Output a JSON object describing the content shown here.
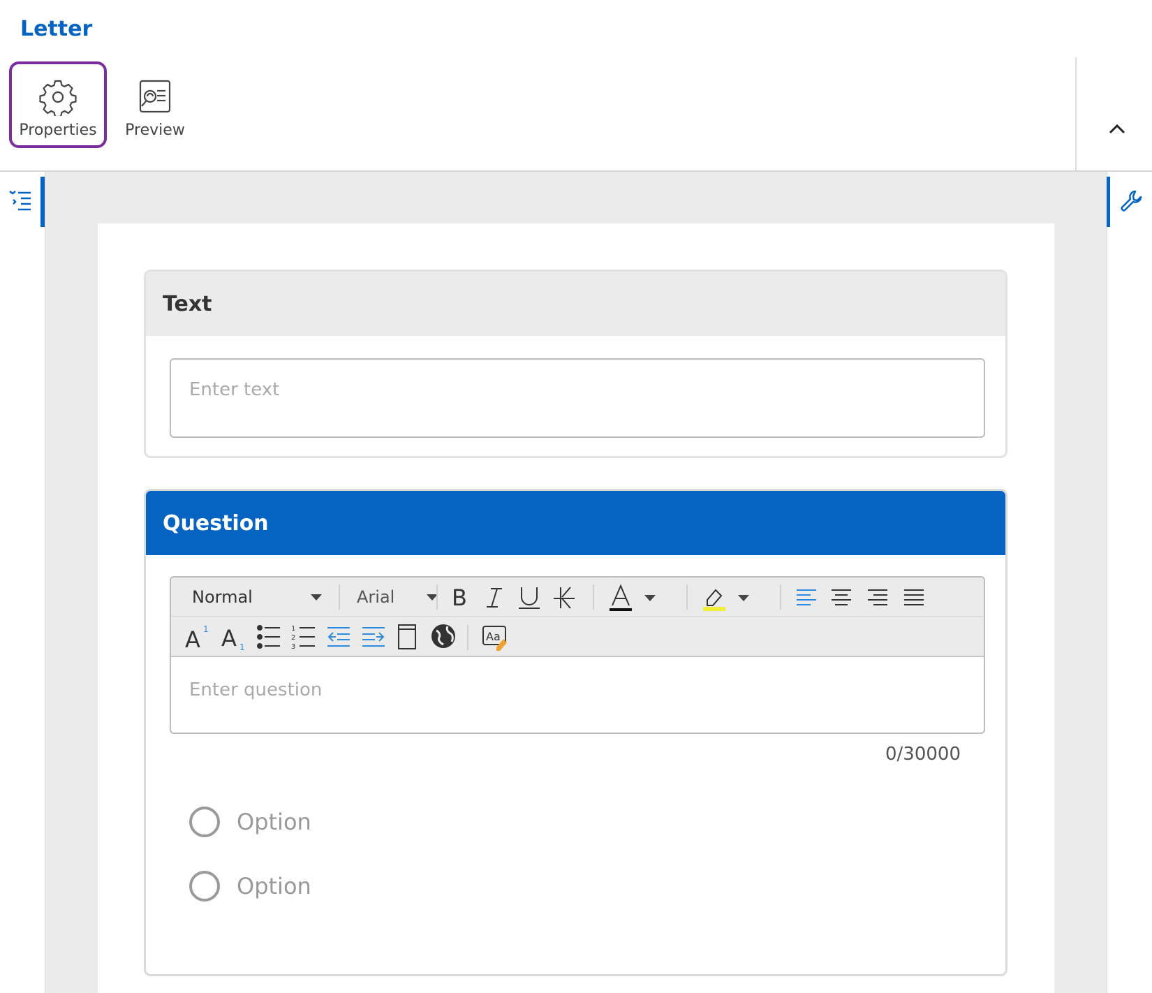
{
  "app": {
    "title": "Letter"
  },
  "toolbar": {
    "properties_label": "Properties",
    "preview_label": "Preview",
    "selected": "Properties",
    "accent_selected": "#7b2d9e"
  },
  "icons": {
    "properties": "gear-icon",
    "preview": "preview-icon",
    "collapse": "chevron-up-icon",
    "outline": "outline-list-icon",
    "tools": "wrench-icon"
  },
  "colors": {
    "brand": "#0563c1",
    "canvas": "#ebebeb"
  },
  "text_block": {
    "header": "Text",
    "input_placeholder": "Enter text"
  },
  "question_block": {
    "header": "Question",
    "editor": {
      "style_select": "Normal",
      "font_select": "Arial",
      "placeholder": "Enter question",
      "buttons": [
        "bold",
        "italic",
        "underline",
        "remove-format",
        "font-color",
        "highlight",
        "align-left",
        "align-center",
        "align-right",
        "justify",
        "superscript",
        "subscript",
        "bulleted-list",
        "numbered-list",
        "outdent",
        "indent",
        "page",
        "language",
        "spell-check"
      ]
    },
    "char_count": "0/30000",
    "options": [
      {
        "label": "Option"
      },
      {
        "label": "Option"
      }
    ]
  }
}
